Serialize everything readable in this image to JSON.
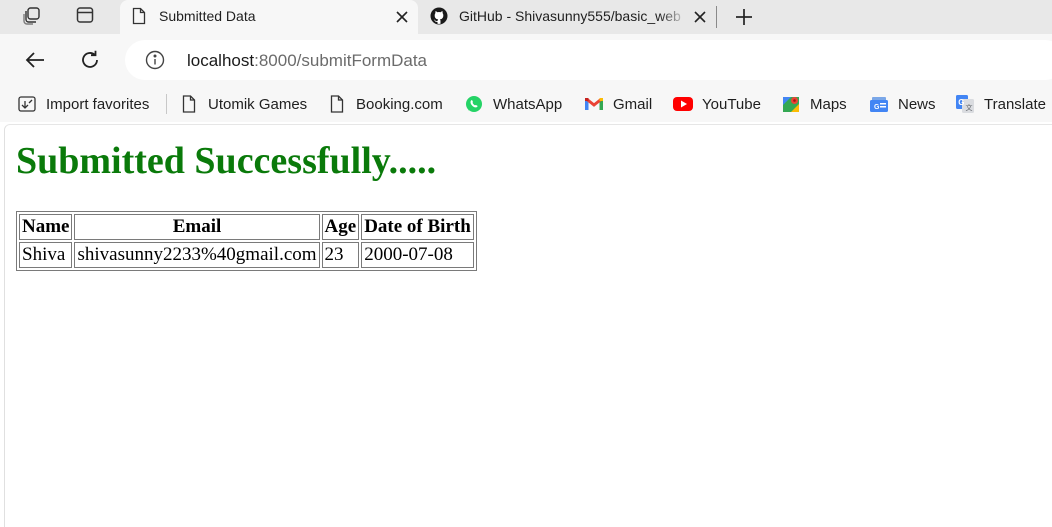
{
  "browser": {
    "tabs": [
      {
        "title": "Submitted Data",
        "icon": "page-icon",
        "active": true
      },
      {
        "title": "GitHub - Shivasunny555/basic_web",
        "icon": "github-icon",
        "active": false
      }
    ],
    "address": {
      "host": "localhost",
      "rest": ":8000/submitFormData"
    },
    "favorites": [
      {
        "label": "Import favorites",
        "icon": "import-favorites-icon"
      },
      {
        "label": "Utomik Games",
        "icon": "page-icon"
      },
      {
        "label": "Booking.com",
        "icon": "page-icon"
      },
      {
        "label": "WhatsApp",
        "icon": "whatsapp-icon"
      },
      {
        "label": "Gmail",
        "icon": "gmail-icon"
      },
      {
        "label": "YouTube",
        "icon": "youtube-icon"
      },
      {
        "label": "Maps",
        "icon": "maps-icon"
      },
      {
        "label": "News",
        "icon": "news-icon"
      },
      {
        "label": "Translate",
        "icon": "translate-icon"
      }
    ],
    "colors": {
      "chrome": "#f7f7f7",
      "tabstrip": "#e8e8e8",
      "heading": "#0a7a0a"
    }
  },
  "page": {
    "heading": "Submitted Successfully.....",
    "table": {
      "headers": [
        "Name",
        "Email",
        "Age",
        "Date of Birth"
      ],
      "rows": [
        [
          "Shiva",
          "shivasunny2233%40gmail.com",
          "23",
          "2000-07-08"
        ]
      ]
    }
  }
}
